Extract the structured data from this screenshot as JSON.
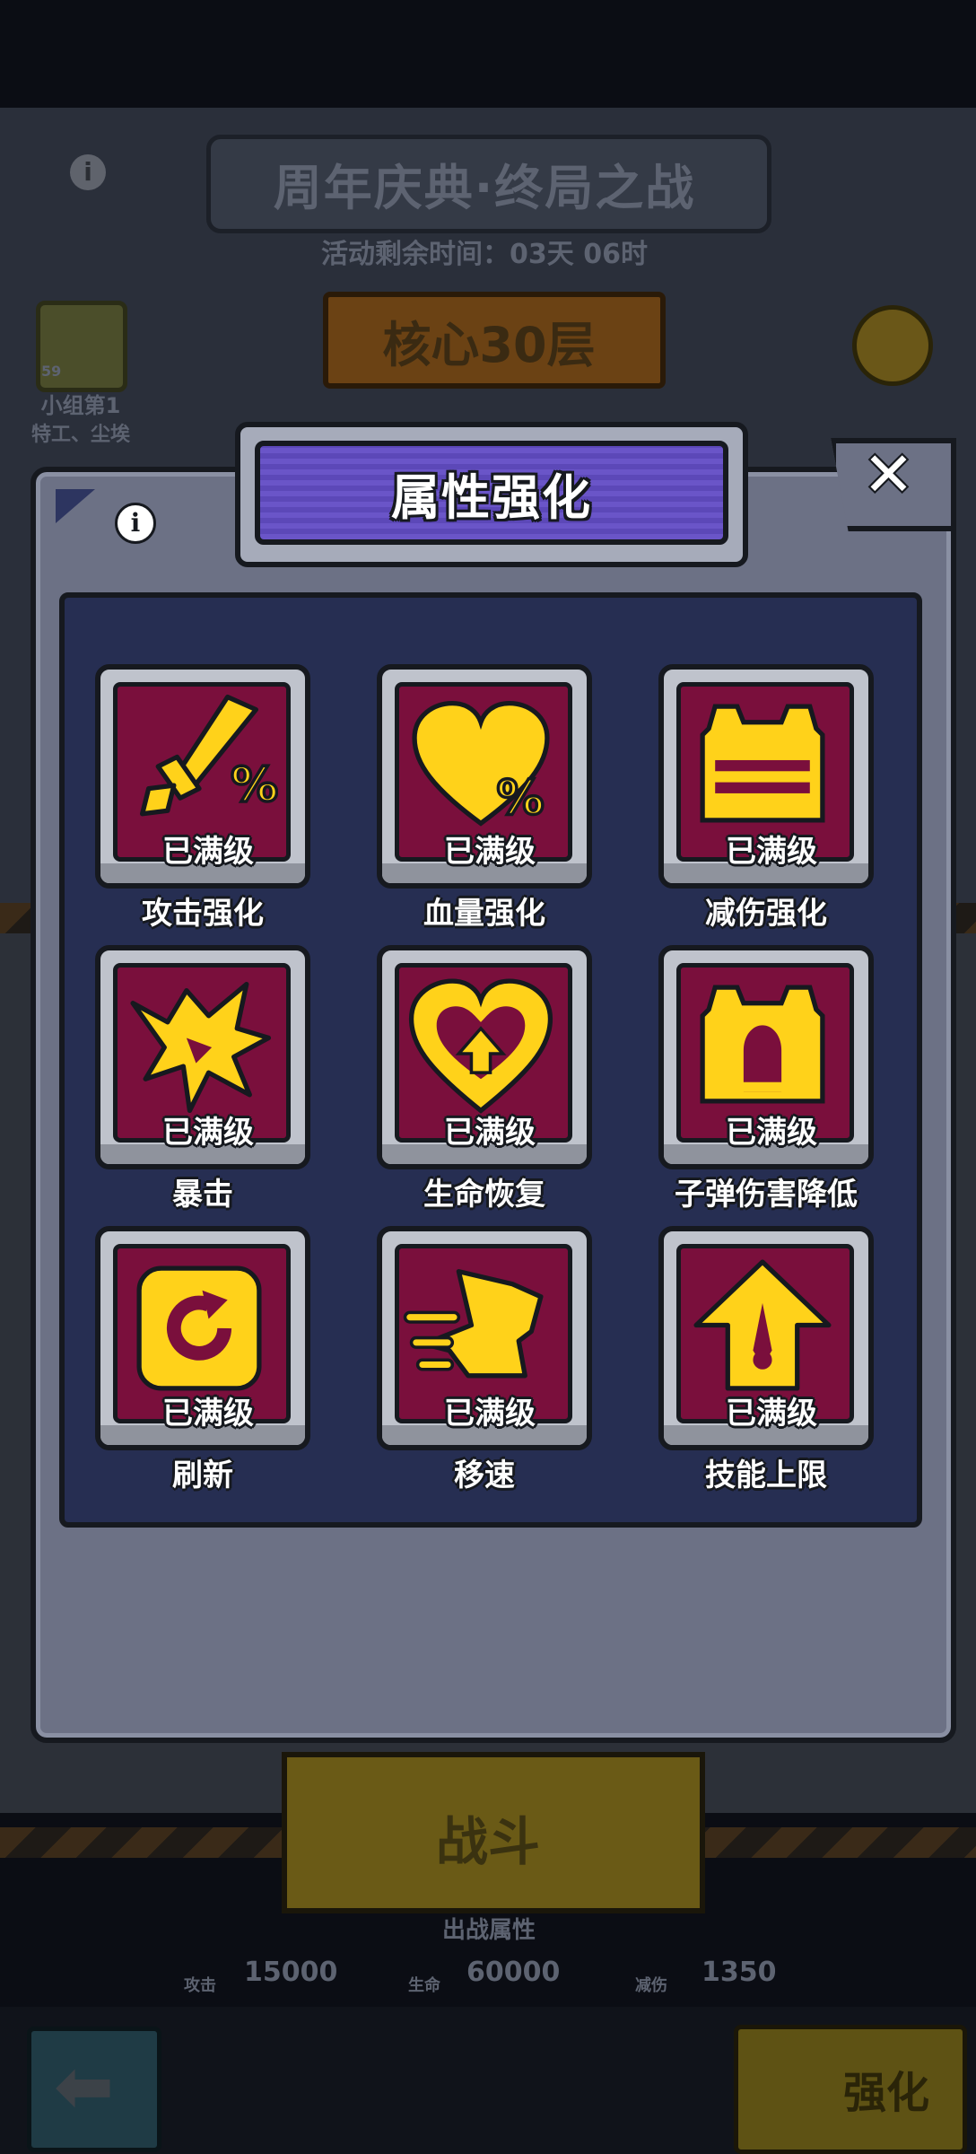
{
  "background": {
    "event_title": "周年庆典·终局之战",
    "timer": "活动剩余时间：03天 06时",
    "floor": "核心30层",
    "rank_level": "59",
    "rank_title": "小组第1",
    "rank_sub": "特工、尘埃",
    "fight_label": "战斗",
    "battle_attr_title": "出战属性",
    "stats": [
      {
        "label": "攻击",
        "value": "15000"
      },
      {
        "label": "生命",
        "value": "60000"
      },
      {
        "label": "减伤",
        "value": "1350"
      }
    ],
    "upgrade_label": "强化"
  },
  "modal": {
    "title": "属性强化",
    "close_glyph": "✕",
    "info_glyph": "i",
    "items": [
      {
        "label": "攻击强化",
        "status": "已满级",
        "icon": "sword-percent-icon"
      },
      {
        "label": "血量强化",
        "status": "已满级",
        "icon": "heart-percent-icon"
      },
      {
        "label": "减伤强化",
        "status": "已满级",
        "icon": "armor-vest-icon"
      },
      {
        "label": "暴击",
        "status": "已满级",
        "icon": "critical-burst-icon"
      },
      {
        "label": "生命恢复",
        "status": "已满级",
        "icon": "heart-regen-icon"
      },
      {
        "label": "子弹伤害降低",
        "status": "已满级",
        "icon": "bullet-shield-icon"
      },
      {
        "label": "刷新",
        "status": "已满级",
        "icon": "refresh-icon"
      },
      {
        "label": "移速",
        "status": "已满级",
        "icon": "move-speed-icon"
      },
      {
        "label": "技能上限",
        "status": "已满级",
        "icon": "skill-cap-icon"
      }
    ]
  },
  "colors": {
    "icon_yellow": "#ffd21a",
    "tile_red": "#7a0f3c",
    "grid_navy": "#262e52",
    "title_purple": "#6a55c8"
  }
}
